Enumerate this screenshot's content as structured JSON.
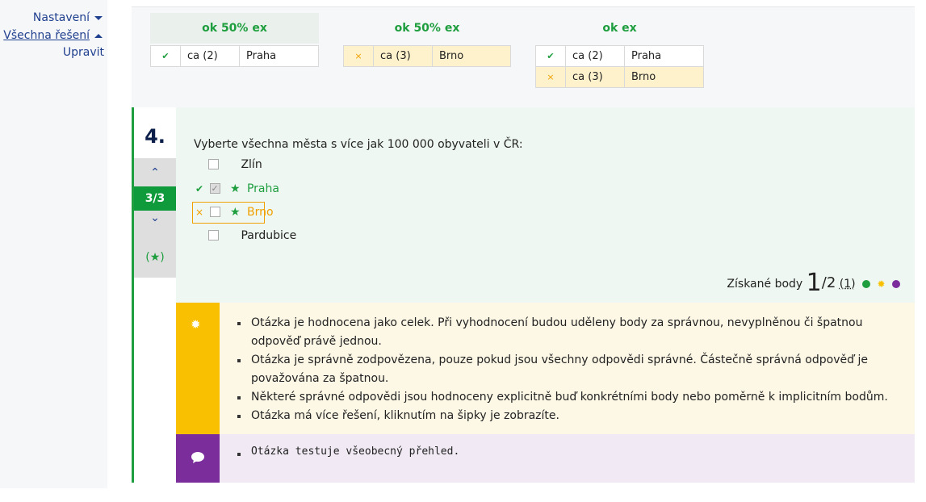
{
  "sidebar": {
    "settings": "Nastavení",
    "all_solutions": "Všechna řešení",
    "edit": "Upravit"
  },
  "solutions": [
    {
      "header": "ok 50% ex",
      "rows": [
        {
          "mark": "✔",
          "status": "ok",
          "value": "ca (2)",
          "city": "Praha"
        }
      ]
    },
    {
      "header": "ok 50% ex",
      "rows": [
        {
          "mark": "×",
          "status": "wrong",
          "value": "ca (3)",
          "city": "Brno"
        }
      ]
    },
    {
      "header": "ok ex",
      "rows": [
        {
          "mark": "✔",
          "status": "ok",
          "value": "ca (2)",
          "city": "Praha"
        },
        {
          "mark": "×",
          "status": "wrong",
          "value": "ca (3)",
          "city": "Brno"
        }
      ]
    }
  ],
  "question": {
    "number": "4.",
    "text": "Vyberte všechna města s více jak 100 000 obyvateli v ČR:",
    "nav_up": "^",
    "counter": "3/3",
    "nav_down": "v",
    "star_marker": "(★)",
    "options": [
      {
        "label": "Zlín",
        "checked": false,
        "state": "none"
      },
      {
        "label": "Praha",
        "checked": true,
        "state": "correct",
        "mark": "✔",
        "star": "★"
      },
      {
        "label": "Brno",
        "checked": false,
        "state": "wrong",
        "mark": "×",
        "star": "★"
      },
      {
        "label": "Pardubice",
        "checked": false,
        "state": "none"
      }
    ],
    "score_label": "Získané body",
    "score_value": "1",
    "score_max": "/2",
    "score_extra": "(1)"
  },
  "hints": [
    "Otázka je hodnocena jako celek. Při vyhodnocení budou uděleny body za správnou, nevyplněnou či špatnou odpověď právě jednou.",
    "Otázka je správně zodpovězena, pouze pokud jsou všechny odpovědi správné. Částečně správná odpověď je považována za špatnou.",
    "Některé správné odpovědi jsou hodnoceny explicitně buď konkrétními body nebo poměrně k implicitním bodům.",
    "Otázka má více řešení, kliknutím na šipky je zobrazíte."
  ],
  "comment": "Otázka testuje všeobecný přehled.",
  "colors": {
    "green": "#1e9e3e",
    "orange": "#f0a000",
    "hint": "#f8c000",
    "comment": "#7b2d9b"
  },
  "icons": {
    "hint": "lightbulb-icon",
    "comment": "speech-bubble-icon",
    "info": "info-icon"
  }
}
